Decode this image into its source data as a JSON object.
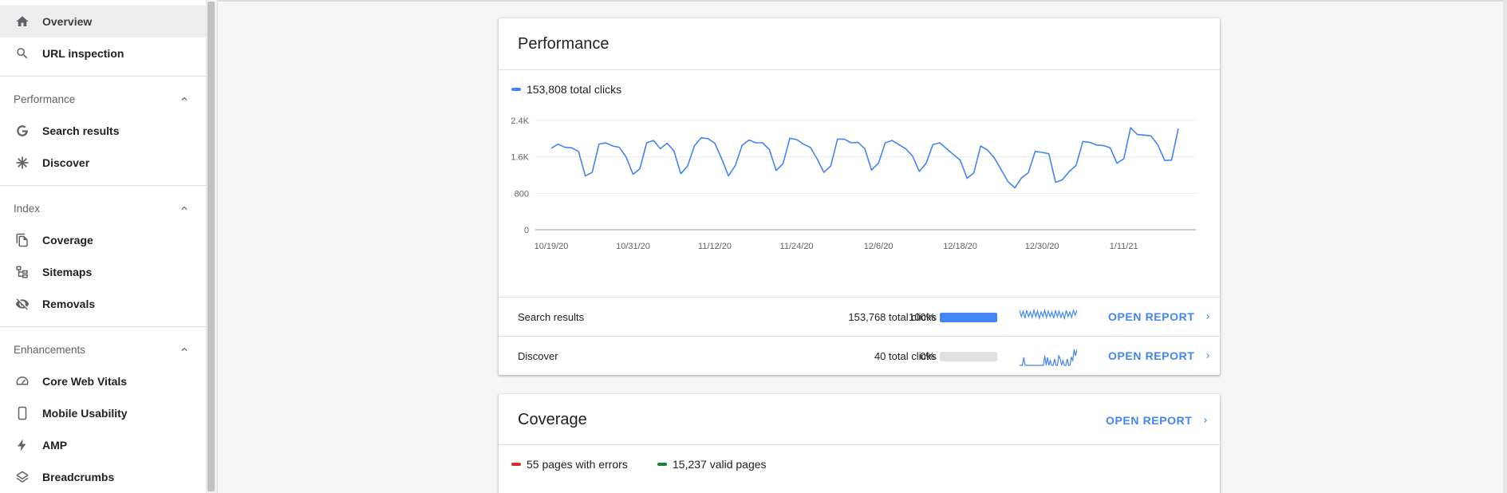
{
  "sidebar": {
    "top_items": [
      {
        "label": "Overview",
        "icon": "home-icon",
        "active": true
      },
      {
        "label": "URL inspection",
        "icon": "search-icon",
        "active": false
      }
    ],
    "sections": [
      {
        "title": "Performance",
        "items": [
          {
            "label": "Search results",
            "icon": "google-g-icon"
          },
          {
            "label": "Discover",
            "icon": "asterisk-icon"
          }
        ]
      },
      {
        "title": "Index",
        "items": [
          {
            "label": "Coverage",
            "icon": "pages-icon"
          },
          {
            "label": "Sitemaps",
            "icon": "sitemap-icon"
          },
          {
            "label": "Removals",
            "icon": "eye-off-icon"
          }
        ]
      },
      {
        "title": "Enhancements",
        "items": [
          {
            "label": "Core Web Vitals",
            "icon": "gauge-icon"
          },
          {
            "label": "Mobile Usability",
            "icon": "phone-icon"
          },
          {
            "label": "AMP",
            "icon": "bolt-icon"
          },
          {
            "label": "Breadcrumbs",
            "icon": "layers-icon"
          }
        ]
      }
    ]
  },
  "performance": {
    "title": "Performance",
    "legend": "153,808 total clicks",
    "legend_color": "#4285f4",
    "rows": [
      {
        "name": "Search results",
        "clicks": "153,768 total clicks",
        "percent": "100%",
        "share": 1.0,
        "action": "OPEN REPORT"
      },
      {
        "name": "Discover",
        "clicks": "40 total clicks",
        "percent": "0%",
        "share": 0.0,
        "action": "OPEN REPORT"
      }
    ]
  },
  "coverage": {
    "title": "Coverage",
    "action": "OPEN REPORT",
    "legend": [
      {
        "label": "55 pages with errors",
        "color": "#d93025"
      },
      {
        "label": "15,237 valid pages",
        "color": "#188038"
      }
    ]
  },
  "chart_data": {
    "type": "line",
    "title": "",
    "xlabel": "",
    "ylabel": "",
    "ylim": [
      0,
      2400
    ],
    "y_ticks": [
      "0",
      "800",
      "1.6K",
      "2.4K"
    ],
    "y_tick_values": [
      0,
      800,
      1600,
      2400
    ],
    "x_tick_labels": [
      "10/19/20",
      "10/31/20",
      "11/12/20",
      "11/24/20",
      "12/6/20",
      "12/18/20",
      "12/30/20",
      "1/11/21"
    ],
    "x_start": "10/19/20",
    "grid": true,
    "series": [
      {
        "name": "Clicks",
        "color": "#4285f4",
        "values": [
          1790,
          1880,
          1810,
          1800,
          1720,
          1180,
          1260,
          1880,
          1910,
          1840,
          1810,
          1590,
          1220,
          1340,
          1910,
          1960,
          1780,
          1900,
          1730,
          1230,
          1400,
          1840,
          2020,
          2000,
          1900,
          1560,
          1180,
          1410,
          1850,
          1970,
          1910,
          1910,
          1760,
          1300,
          1450,
          2010,
          1980,
          1880,
          1810,
          1560,
          1260,
          1400,
          1990,
          1990,
          1910,
          1920,
          1780,
          1310,
          1460,
          1910,
          1960,
          1870,
          1780,
          1620,
          1280,
          1460,
          1870,
          1910,
          1780,
          1650,
          1530,
          1130,
          1250,
          1840,
          1750,
          1580,
          1320,
          1060,
          920,
          1140,
          1250,
          1720,
          1700,
          1670,
          1040,
          1100,
          1280,
          1410,
          1940,
          1920,
          1860,
          1850,
          1800,
          1460,
          1560,
          2240,
          2090,
          2080,
          2060,
          1860,
          1520,
          1530,
          2220
        ]
      }
    ]
  },
  "sparklines": {
    "search_results": [
      1.0,
      0.6,
      0.95,
      0.5,
      1.0,
      0.6,
      0.9,
      0.55,
      1.0,
      0.6,
      0.95,
      0.5,
      0.9,
      0.6,
      1.0,
      0.55,
      0.95,
      0.6,
      0.9,
      0.5,
      1.0,
      0.6,
      0.95,
      0.55,
      0.85,
      0.5,
      1.0,
      0.6,
      0.9,
      0.55,
      1.0,
      0.7,
      1.0
    ],
    "discover": [
      0,
      0,
      0,
      0.5,
      0,
      0,
      0,
      0,
      0,
      0,
      0,
      0,
      0,
      0,
      0,
      0,
      0,
      0,
      0.6,
      0,
      0.5,
      0,
      0.3,
      0,
      0,
      0.4,
      0,
      0,
      0.6,
      0.4,
      0,
      0.3,
      0,
      0,
      0.4,
      0,
      0,
      0.5,
      0.3,
      1.0,
      0.6,
      1.0
    ]
  }
}
